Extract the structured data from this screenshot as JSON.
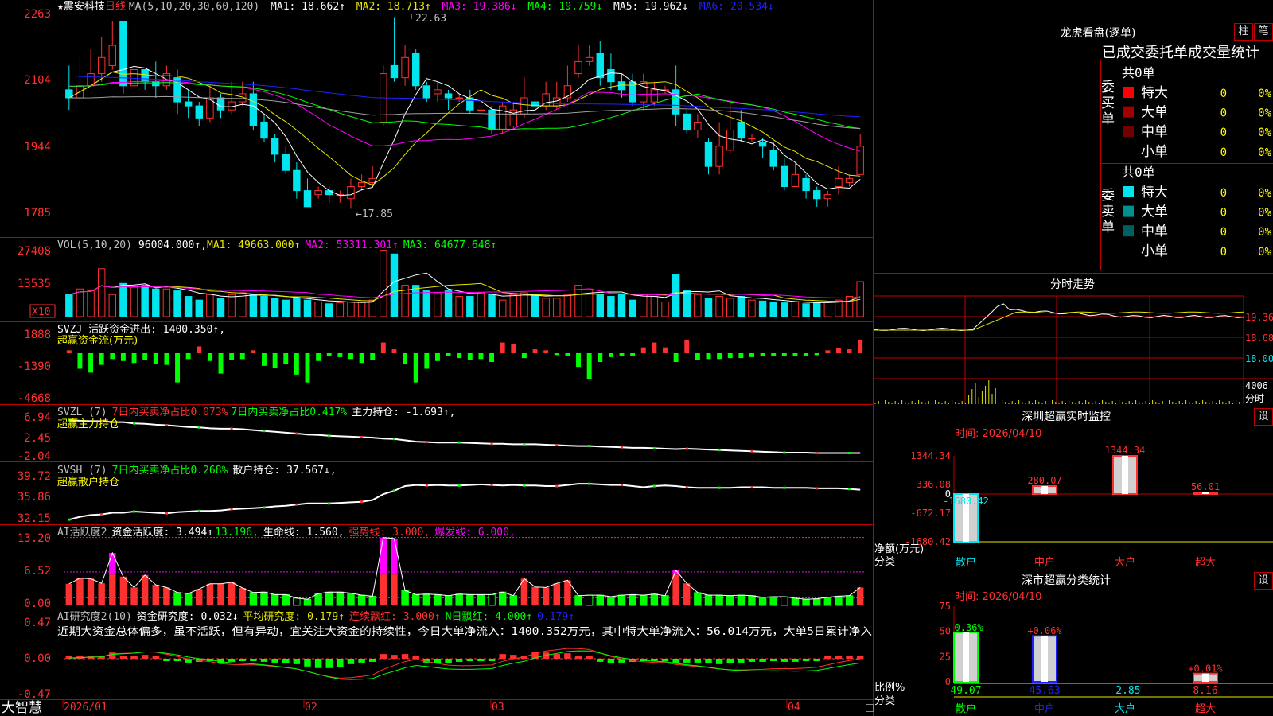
{
  "colors": {
    "up": "#ff3030",
    "down": "#00e5ee",
    "ma5": "#ffffff",
    "ma10": "#e6e600",
    "ma20": "#ff00ff",
    "ma30": "#00ff00",
    "ma60": "#a0a0a0",
    "ma120": "#2020ff",
    "frame": "#c00000",
    "green": "#00ff00",
    "label": "#ffff00"
  },
  "header": {
    "symbol": "★震安科技",
    "period": "日线",
    "ma_label": "MA(5,10,20,30,60,120)",
    "ma_values": [
      {
        "text": "MA1: 18.662↑",
        "color": "#ffffff"
      },
      {
        "text": "MA2: 18.713↑",
        "color": "#e6e600"
      },
      {
        "text": "MA3: 19.386↓",
        "color": "#ff00ff"
      },
      {
        "text": "MA4: 19.759↓",
        "color": "#00ff00"
      },
      {
        "text": "MA5: 19.962↓",
        "color": "#ffffff"
      },
      {
        "text": "MA6: 20.534↓",
        "color": "#2020ff"
      }
    ],
    "high_mark": "22.63",
    "low_mark": "←17.85"
  },
  "price_axis": [
    "2263",
    "2104",
    "1944",
    "1785"
  ],
  "vol": {
    "label": "VOL(5,10,20)",
    "value": "96004.000↑,",
    "ma1": "MA1: 49663.000↑",
    "ma2": "MA2: 53311.301↑",
    "ma3": "MA3: 64677.648↑",
    "axis": [
      "27408",
      "13535"
    ],
    "unit": "X10"
  },
  "svzj": {
    "label": "SVZJ  活跃资金进出: 1400.350↑,",
    "sub": "超赢资金流(万元)",
    "axis": [
      "1888",
      "-1390",
      "-4668"
    ]
  },
  "svzl": {
    "label": "SVZL (7)",
    "t1": "7日内买卖净占比0.073%",
    "t2": "7日内买卖净占比0.417%",
    "t3": "主力持仓: -1.693↑,",
    "sub": "超赢主力持仓",
    "axis": [
      "6.94",
      "2.45",
      "-2.04"
    ]
  },
  "svsh": {
    "label": "SVSH (7)",
    "t1": "7日内买卖净占比0.268%",
    "t2": "散户持仓: 37.567↓,",
    "sub": "超赢散户持仓",
    "axis": [
      "39.72",
      "35.86",
      "32.15"
    ]
  },
  "ai": {
    "label": "AI活跃度2",
    "t1": "资金活跃度: 3.494↑",
    "t2": "13.196,",
    "t3": "生命线: 1.560,",
    "t4": "强势线: 3.000,",
    "t5": "爆发线: 6.000,",
    "axis": [
      "13.20",
      "6.52",
      "0.00"
    ]
  },
  "ai2": {
    "label": "AI研究度2(10)",
    "t1": "资金研究度: 0.032↓",
    "t2": "平均研究度: 0.179↑",
    "t3": "连续飘红: 3.000↑",
    "t4": "N日飘红: 4.000↑",
    "t5": "0.179↑",
    "comment": "近期大资金总体偏多，虽不活跃，但有异动，宜关注大资金的持续性，今日大单净流入：1400.352万元，其中特大单净流入：56.014万元，大单5日累计净入",
    "axis": [
      "0.47",
      "0.00",
      "-0.47"
    ]
  },
  "bottom": {
    "brand": "大智慧",
    "dates": [
      "2026/01",
      "02",
      "03",
      "04"
    ]
  },
  "right": {
    "title": "龙虎看盘(逐单)",
    "btn_zhu": "柱",
    "btn_bi": "笔",
    "subtitle": "已成交委托单成交量统计",
    "buy": {
      "label": "委买单",
      "count": "共0单",
      "rows": [
        {
          "name": "特大",
          "v": "0",
          "p": "0%",
          "color": "#ff0000"
        },
        {
          "name": "大单",
          "v": "0",
          "p": "0%",
          "color": "#a00000"
        },
        {
          "name": "中单",
          "v": "0",
          "p": "0%",
          "color": "#700000"
        },
        {
          "name": "小单",
          "v": "0",
          "p": "0%",
          "color": ""
        }
      ]
    },
    "sell": {
      "label": "委卖单",
      "count": "共0单",
      "rows": [
        {
          "name": "特大",
          "v": "0",
          "p": "0%",
          "color": "#00e5ee"
        },
        {
          "name": "大单",
          "v": "0",
          "p": "0%",
          "color": "#009090"
        },
        {
          "name": "中单",
          "v": "0",
          "p": "0%",
          "color": "#006060"
        },
        {
          "name": "小单",
          "v": "0",
          "p": "0%",
          "color": ""
        }
      ]
    },
    "intraday": {
      "title": "分时走势",
      "axis": [
        "19.36",
        "18.68",
        "18.00"
      ],
      "vol_axis": "4006",
      "vol_unit": "分时"
    },
    "sz_monitor": {
      "title": "深圳超赢实时监控",
      "set": "设",
      "time": "时间: 2026/04/10",
      "ylabel": "净额(万元)",
      "xlabel": "分类",
      "axis": [
        "1344.34",
        "336.08",
        "0",
        "-672.17",
        "-1680.42"
      ]
    },
    "sz_stats": {
      "title": "深市超赢分类统计",
      "set": "设",
      "time": "时间: 2026/04/10",
      "ylabel": "比例%",
      "xlabel": "分类",
      "axis": [
        "75",
        "50",
        "25",
        "0"
      ]
    }
  },
  "chart_data": [
    {
      "type": "candlestick",
      "title": "震安科技 日线",
      "x_start": "2026/01",
      "x_end": "2026/04",
      "y_range": [
        17.85,
        22.63
      ],
      "candles": [
        [
          20.8,
          20.6,
          21.4,
          20.3
        ],
        [
          20.6,
          20.9,
          21.6,
          20.5
        ],
        [
          20.9,
          21.2,
          21.8,
          20.9
        ],
        [
          21.2,
          21.6,
          22.1,
          21.0
        ],
        [
          21.4,
          21.9,
          22.5,
          21.3
        ],
        [
          22.5,
          20.9,
          22.5,
          20.7
        ],
        [
          20.9,
          21.3,
          22.4,
          20.8
        ],
        [
          21.3,
          21.0,
          21.3,
          20.8
        ],
        [
          21.0,
          20.9,
          21.5,
          20.6
        ],
        [
          20.9,
          21.2,
          21.4,
          20.8
        ],
        [
          21.1,
          20.5,
          21.3,
          20.2
        ],
        [
          20.5,
          20.4,
          20.8,
          20.1
        ],
        [
          20.4,
          20.1,
          20.5,
          19.9
        ],
        [
          20.1,
          20.6,
          20.9,
          20.0
        ],
        [
          20.6,
          20.3,
          20.7,
          20.1
        ],
        [
          20.3,
          20.5,
          21.0,
          20.2
        ],
        [
          20.5,
          20.7,
          21.0,
          20.4
        ],
        [
          20.7,
          19.9,
          21.0,
          19.8
        ],
        [
          20.0,
          19.6,
          20.2,
          19.5
        ],
        [
          19.6,
          19.2,
          19.7,
          19.0
        ],
        [
          19.2,
          18.8,
          19.4,
          18.7
        ],
        [
          18.8,
          18.3,
          19.0,
          18.1
        ],
        [
          18.3,
          17.9,
          18.6,
          17.9
        ],
        [
          18.2,
          18.3,
          18.4,
          18.1
        ],
        [
          18.3,
          18.2,
          18.4,
          18.0
        ],
        [
          18.2,
          18.2,
          18.3,
          18.0
        ],
        [
          18.1,
          18.4,
          18.6,
          17.85
        ],
        [
          18.4,
          18.5,
          18.7,
          18.3
        ],
        [
          18.5,
          18.6,
          18.9,
          18.4
        ],
        [
          20.0,
          21.2,
          21.4,
          19.9
        ],
        [
          21.4,
          21.1,
          22.6,
          21.0
        ],
        [
          21.1,
          21.6,
          21.9,
          20.9
        ],
        [
          21.7,
          20.9,
          21.8,
          20.8
        ],
        [
          20.9,
          20.6,
          21.0,
          20.5
        ],
        [
          20.7,
          20.8,
          21.0,
          20.5
        ],
        [
          20.7,
          20.6,
          20.8,
          20.3
        ],
        [
          20.6,
          20.6,
          20.7,
          20.5
        ],
        [
          20.6,
          20.3,
          20.8,
          20.2
        ],
        [
          20.3,
          20.3,
          20.6,
          20.2
        ],
        [
          20.3,
          19.8,
          20.4,
          19.7
        ],
        [
          19.8,
          20.4,
          20.5,
          19.7
        ],
        [
          19.9,
          20.3,
          20.5,
          19.8
        ],
        [
          20.2,
          20.6,
          21.1,
          20.1
        ],
        [
          20.5,
          20.4,
          20.8,
          20.2
        ],
        [
          20.4,
          20.7,
          21.0,
          20.3
        ],
        [
          20.4,
          20.6,
          21.0,
          20.3
        ],
        [
          20.6,
          20.9,
          21.4,
          20.5
        ],
        [
          21.2,
          21.5,
          21.9,
          21.1
        ],
        [
          21.5,
          21.6,
          21.9,
          21.4
        ],
        [
          21.7,
          21.1,
          22.0,
          20.9
        ],
        [
          21.3,
          21.0,
          21.7,
          20.8
        ],
        [
          21.0,
          20.8,
          21.2,
          20.6
        ],
        [
          21.0,
          20.5,
          21.2,
          20.4
        ],
        [
          20.5,
          21.0,
          21.2,
          20.3
        ],
        [
          20.5,
          20.8,
          21.0,
          20.4
        ],
        [
          20.8,
          20.8,
          20.9,
          20.7
        ],
        [
          20.8,
          20.2,
          21.4,
          19.9
        ],
        [
          20.2,
          19.8,
          20.3,
          19.7
        ],
        [
          19.8,
          20.0,
          20.2,
          19.6
        ],
        [
          19.5,
          18.9,
          19.6,
          18.7
        ],
        [
          18.9,
          19.4,
          20.0,
          18.7
        ],
        [
          19.3,
          19.8,
          20.5,
          19.2
        ],
        [
          20.0,
          19.6,
          20.3,
          19.5
        ],
        [
          19.6,
          19.6,
          19.7,
          19.5
        ],
        [
          19.5,
          19.4,
          19.6,
          19.1
        ],
        [
          19.3,
          18.9,
          19.5,
          18.8
        ],
        [
          18.9,
          18.4,
          19.1,
          18.3
        ],
        [
          18.4,
          18.7,
          19.0,
          18.4
        ],
        [
          18.6,
          18.3,
          18.7,
          18.1
        ],
        [
          18.3,
          18.1,
          18.4,
          17.9
        ],
        [
          18.1,
          18.2,
          18.3,
          17.9
        ],
        [
          18.4,
          18.6,
          18.9,
          18.2
        ],
        [
          18.5,
          18.6,
          18.7,
          18.4
        ],
        [
          18.7,
          19.4,
          19.7,
          18.7
        ]
      ]
    },
    {
      "type": "bar",
      "title": "VOL(5,10,20)",
      "unit": "X10",
      "values": [
        12000,
        15000,
        14000,
        26000,
        12000,
        18000,
        16000,
        17000,
        15000,
        15000,
        14000,
        11000,
        9000,
        12000,
        10000,
        12000,
        13000,
        12000,
        11000,
        10000,
        9000,
        10000,
        9000,
        8000,
        7000,
        7500,
        8000,
        8000,
        9000,
        36000,
        34000,
        17000,
        17000,
        14000,
        13000,
        14000,
        11000,
        11000,
        13000,
        12000,
        9000,
        12000,
        13000,
        12000,
        10000,
        10000,
        12000,
        17000,
        15000,
        12000,
        11000,
        12000,
        9000,
        12000,
        11000,
        8000,
        23000,
        14000,
        12000,
        10000,
        11000,
        10000,
        11000,
        9000,
        8500,
        8000,
        7500,
        8000,
        7000,
        7500,
        8000,
        9000,
        11000,
        19000
      ]
    },
    {
      "type": "bar",
      "title": "SVZJ 活跃资金进出",
      "values": [
        300,
        -1600,
        -2000,
        -1200,
        -600,
        -800,
        -1000,
        -700,
        -1100,
        -1200,
        -3000,
        -600,
        700,
        -800,
        -2100,
        -700,
        -600,
        300,
        -1300,
        -1500,
        -1100,
        -2200,
        -3000,
        -800,
        -250,
        -400,
        -600,
        -1000,
        -700,
        1100,
        400,
        -1100,
        -3000,
        -1600,
        -800,
        -300,
        -500,
        -700,
        -600,
        -900,
        1100,
        900,
        -500,
        400,
        300,
        -200,
        -250,
        -1400,
        -2700,
        -900,
        -400,
        -250,
        -300,
        600,
        1100,
        600,
        -900,
        1400,
        -700,
        -600,
        -600,
        -500,
        -500,
        -400,
        -300,
        -300,
        -250,
        -300,
        -300,
        -200,
        300,
        500,
        400,
        1400
      ]
    },
    {
      "type": "line",
      "title": "SVZL 主力持仓",
      "y_range": [
        -2.04,
        6.94
      ],
      "values": [
        6.7,
        6.6,
        6.5,
        6.5,
        6.3,
        6.3,
        6.0,
        5.9,
        5.7,
        5.6,
        5.4,
        5.2,
        5.1,
        4.9,
        4.8,
        4.8,
        4.7,
        4.5,
        4.3,
        4.1,
        3.9,
        3.7,
        3.5,
        3.4,
        3.2,
        3.1,
        3.0,
        2.9,
        2.8,
        2.6,
        2.5,
        2.2,
        1.9,
        1.8,
        1.7,
        1.7,
        1.7,
        1.6,
        1.5,
        1.4,
        1.4,
        1.3,
        1.3,
        1.3,
        1.2,
        1.1,
        1.0,
        0.9,
        0.9,
        0.8,
        0.7,
        0.6,
        0.5,
        0.5,
        0.4,
        0.3,
        0.2,
        0.3,
        0.2,
        0.1,
        0.0,
        -0.1,
        -0.2,
        -0.3,
        -0.4,
        -0.5,
        -0.6,
        -0.6,
        -0.6,
        -0.7,
        -0.7,
        -0.7,
        -0.7,
        -0.7
      ]
    },
    {
      "type": "line",
      "title": "SVSH 散户持仓",
      "y_range": [
        32.15,
        39.72
      ],
      "values": [
        32.4,
        32.9,
        33.2,
        33.3,
        33.6,
        33.6,
        33.8,
        33.7,
        33.6,
        33.5,
        33.7,
        33.8,
        33.9,
        33.9,
        34.0,
        34.2,
        34.3,
        34.4,
        34.5,
        34.7,
        34.8,
        35.0,
        35.2,
        35.2,
        35.2,
        35.3,
        35.4,
        35.5,
        35.8,
        36.8,
        37.4,
        38.2,
        38.4,
        38.3,
        38.4,
        38.3,
        38.3,
        38.4,
        38.5,
        38.4,
        38.3,
        38.4,
        38.3,
        38.3,
        38.2,
        38.2,
        38.4,
        38.6,
        38.6,
        38.5,
        38.4,
        38.4,
        38.2,
        38.0,
        38.2,
        38.3,
        38.2,
        38.0,
        37.9,
        37.9,
        37.9,
        37.9,
        38.0,
        38.0,
        38.0,
        37.9,
        37.9,
        37.9,
        37.9,
        37.8,
        37.8,
        37.8,
        37.7,
        37.567
      ]
    },
    {
      "type": "bar",
      "title": "AI活跃度2 资金活跃度",
      "values": [
        4.2,
        5.3,
        5.2,
        4.3,
        10.2,
        5.6,
        3.5,
        5.9,
        4.0,
        3.5,
        2.5,
        2.3,
        3.2,
        4.2,
        4.2,
        4.5,
        3.4,
        2.5,
        2.6,
        2.1,
        2.1,
        1.4,
        1.2,
        2.3,
        2.6,
        2.6,
        2.4,
        2.0,
        1.8,
        13.196,
        13.0,
        2.9,
        2.1,
        2.2,
        2.1,
        1.9,
        2.2,
        2.1,
        2.1,
        2.1,
        2.6,
        1.9,
        5.2,
        3.6,
        3.5,
        4.3,
        4.9,
        1.9,
        2.0,
        2.0,
        1.7,
        2.0,
        2.1,
        2.0,
        2.2,
        1.9,
        6.8,
        4.3,
        2.5,
        2.0,
        2.0,
        1.9,
        2.0,
        1.9,
        1.6,
        1.7,
        1.7,
        1.4,
        1.2,
        1.3,
        1.6,
        1.8,
        1.9,
        3.494
      ]
    },
    {
      "type": "bar",
      "title": "AI研究度2(10) 资金研究度",
      "values": [
        0.02,
        0.01,
        0.02,
        0.01,
        0.08,
        0.03,
        0.03,
        0.05,
        0.02,
        -0.02,
        -0.03,
        -0.05,
        -0.04,
        -0.03,
        -0.06,
        -0.04,
        -0.03,
        -0.03,
        -0.04,
        -0.05,
        -0.06,
        -0.07,
        -0.1,
        -0.12,
        -0.12,
        -0.11,
        -0.07,
        -0.05,
        -0.04,
        0.06,
        0.05,
        0.06,
        0.04,
        -0.05,
        -0.06,
        -0.06,
        -0.04,
        -0.03,
        -0.02,
        -0.02,
        0.06,
        0.05,
        0.04,
        0.09,
        0.08,
        0.06,
        0.07,
        0.04,
        0.02,
        -0.04,
        -0.06,
        -0.05,
        -0.04,
        -0.03,
        -0.03,
        -0.02,
        -0.06,
        -0.05,
        -0.05,
        -0.06,
        -0.07,
        -0.06,
        -0.05,
        -0.04,
        -0.04,
        -0.03,
        -0.04,
        -0.04,
        -0.03,
        -0.02,
        0.02,
        0.03,
        0.03,
        0.032
      ]
    },
    {
      "type": "bar",
      "title": "深圳超赢实时监控",
      "categories": [
        "散户",
        "中户",
        "大户",
        "超大"
      ],
      "values": [
        -1680.42,
        280.07,
        1344.34,
        56.01
      ],
      "y_range": [
        -1680.42,
        1344.34
      ]
    },
    {
      "type": "bar",
      "title": "深市超赢分类统计",
      "categories": [
        "散户",
        "中户",
        "大户",
        "超大"
      ],
      "values": [
        49.07,
        45.63,
        -2.85,
        8.16
      ],
      "deltas": [
        "-0.36%",
        "+0.06%",
        "",
        "+0.01%"
      ],
      "y_range": [
        0,
        75
      ]
    }
  ]
}
